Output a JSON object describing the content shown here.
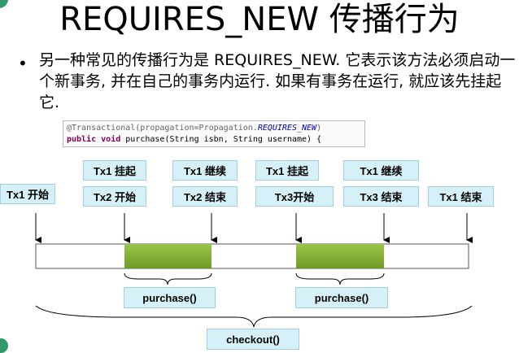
{
  "title": "REQUIRES_NEW 传播行为",
  "bullet_symbol": "•",
  "paragraph": "另一种常见的传播行为是 REQUIRES_NEW. 它表示该方法必须启动一个新事务, 并在自己的事务内运行. 如果有事务在运行, 就应该先挂起它.",
  "code": {
    "line1": {
      "annotation": "@Transactional(propagation=Propagation.",
      "enum_value": "REQUIRES_NEW",
      "close": ")"
    },
    "line2": {
      "keyword1": "public",
      "keyword2": "void",
      "rest": "purchase(String isbn, String username) {"
    }
  },
  "labels": {
    "tx1_start": "Tx1 开始",
    "tx2_start": "Tx2 开始",
    "tx1_suspend_a": "Tx1 挂起",
    "tx1_resume_a": "Tx1 继续",
    "tx2_end": "Tx2 结束",
    "tx1_suspend_b": "Tx1 挂起",
    "tx3_start": "Tx3开始",
    "tx1_resume_b": "Tx1 继续",
    "tx3_end": "Tx3 结束",
    "tx1_end": "Tx1 结束",
    "purchase_a": "purchase()",
    "purchase_b": "purchase()",
    "checkout": "checkout()"
  },
  "colors": {
    "label_fill": "#d6f0f7",
    "label_border": "#9fcfe0",
    "tx_block_fill": "#8db53a",
    "timeline_border": "#555555"
  }
}
